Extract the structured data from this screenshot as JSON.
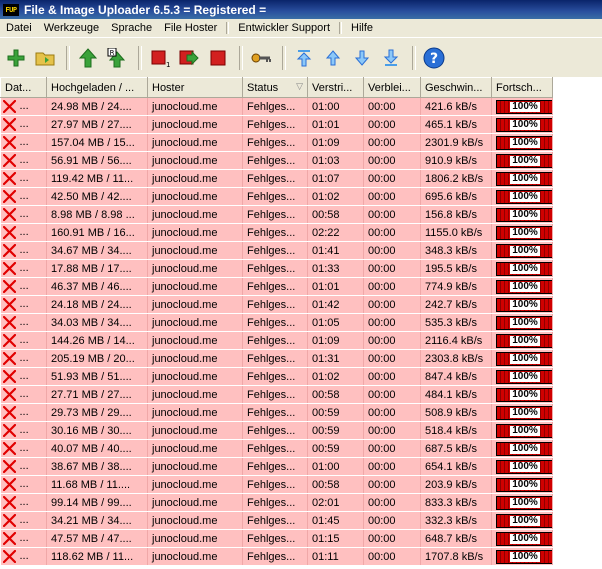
{
  "window": {
    "title": "File & Image Uploader 6.5.3  = Registered =",
    "app_icon_text": "FUP"
  },
  "menu": [
    "Datei",
    "Werkzeuge",
    "Sprache",
    "File Hoster",
    "Entwickler Support",
    "Hilfe"
  ],
  "toolbar": [
    {
      "name": "add-file-icon",
      "color": "#3aa23a"
    },
    {
      "name": "folder-icon",
      "color": "#e5c24a"
    },
    {
      "name": "arrow-up-green-icon",
      "color": "#3aa23a"
    },
    {
      "name": "upload-r-icon",
      "color": "#3aa23a"
    },
    {
      "name": "stop-one-icon",
      "color": "#d22020"
    },
    {
      "name": "stop-arrow-icon",
      "color": "#d22020"
    },
    {
      "name": "stop-all-icon",
      "color": "#d22020"
    },
    {
      "name": "key-icon",
      "color": "#b06a00"
    },
    {
      "name": "move-top-icon",
      "color": "#4a9ee8"
    },
    {
      "name": "move-up-icon",
      "color": "#4a9ee8"
    },
    {
      "name": "move-down-icon",
      "color": "#4a9ee8"
    },
    {
      "name": "move-bottom-icon",
      "color": "#4a9ee8"
    },
    {
      "name": "help-icon",
      "color": "#2a6fd6"
    }
  ],
  "columns": [
    "Dat...",
    "Hochgeladen / ...",
    "Hoster",
    "Status",
    "Verstri...",
    "Verblei...",
    "Geschwin...",
    "Fortsch..."
  ],
  "row_defaults": {
    "name": "...",
    "hoster": "junocloud.me",
    "status": "Fehlges...",
    "remaining": "00:00",
    "progress": "100%"
  },
  "rows": [
    {
      "uploaded": "24.98 MB / 24....",
      "elapsed": "01:00",
      "speed": "421.6 kB/s"
    },
    {
      "uploaded": "27.97 MB / 27....",
      "elapsed": "01:01",
      "speed": "465.1 kB/s"
    },
    {
      "uploaded": "157.04 MB / 15...",
      "elapsed": "01:09",
      "speed": "2301.9 kB/s"
    },
    {
      "uploaded": "56.91 MB / 56....",
      "elapsed": "01:03",
      "speed": "910.9 kB/s"
    },
    {
      "uploaded": "119.42 MB / 11...",
      "elapsed": "01:07",
      "speed": "1806.2 kB/s"
    },
    {
      "uploaded": "42.50 MB / 42....",
      "elapsed": "01:02",
      "speed": "695.6 kB/s"
    },
    {
      "uploaded": "8.98 MB / 8.98 ...",
      "elapsed": "00:58",
      "speed": "156.8 kB/s"
    },
    {
      "uploaded": "160.91 MB / 16...",
      "elapsed": "02:22",
      "speed": "1155.0 kB/s"
    },
    {
      "uploaded": "34.67 MB / 34....",
      "elapsed": "01:41",
      "speed": "348.3 kB/s"
    },
    {
      "uploaded": "17.88 MB / 17....",
      "elapsed": "01:33",
      "speed": "195.5 kB/s"
    },
    {
      "uploaded": "46.37 MB / 46....",
      "elapsed": "01:01",
      "speed": "774.9 kB/s"
    },
    {
      "uploaded": "24.18 MB / 24....",
      "elapsed": "01:42",
      "speed": "242.7 kB/s"
    },
    {
      "uploaded": "34.03 MB / 34....",
      "elapsed": "01:05",
      "speed": "535.3 kB/s"
    },
    {
      "uploaded": "144.26 MB / 14...",
      "elapsed": "01:09",
      "speed": "2116.4 kB/s"
    },
    {
      "uploaded": "205.19 MB / 20...",
      "elapsed": "01:31",
      "speed": "2303.8 kB/s"
    },
    {
      "uploaded": "51.93 MB / 51....",
      "elapsed": "01:02",
      "speed": "847.4 kB/s"
    },
    {
      "uploaded": "27.71 MB / 27....",
      "elapsed": "00:58",
      "speed": "484.1 kB/s"
    },
    {
      "uploaded": "29.73 MB / 29....",
      "elapsed": "00:59",
      "speed": "508.9 kB/s"
    },
    {
      "uploaded": "30.16 MB / 30....",
      "elapsed": "00:59",
      "speed": "518.4 kB/s"
    },
    {
      "uploaded": "40.07 MB / 40....",
      "elapsed": "00:59",
      "speed": "687.5 kB/s"
    },
    {
      "uploaded": "38.67 MB / 38....",
      "elapsed": "01:00",
      "speed": "654.1 kB/s"
    },
    {
      "uploaded": "11.68 MB / 11....",
      "elapsed": "00:58",
      "speed": "203.9 kB/s"
    },
    {
      "uploaded": "99.14 MB / 99....",
      "elapsed": "02:01",
      "speed": "833.3 kB/s"
    },
    {
      "uploaded": "34.21 MB / 34....",
      "elapsed": "01:45",
      "speed": "332.3 kB/s"
    },
    {
      "uploaded": "47.57 MB / 47....",
      "elapsed": "01:15",
      "speed": "648.7 kB/s"
    },
    {
      "uploaded": "118.62 MB / 11...",
      "elapsed": "01:11",
      "speed": "1707.8 kB/s"
    }
  ]
}
